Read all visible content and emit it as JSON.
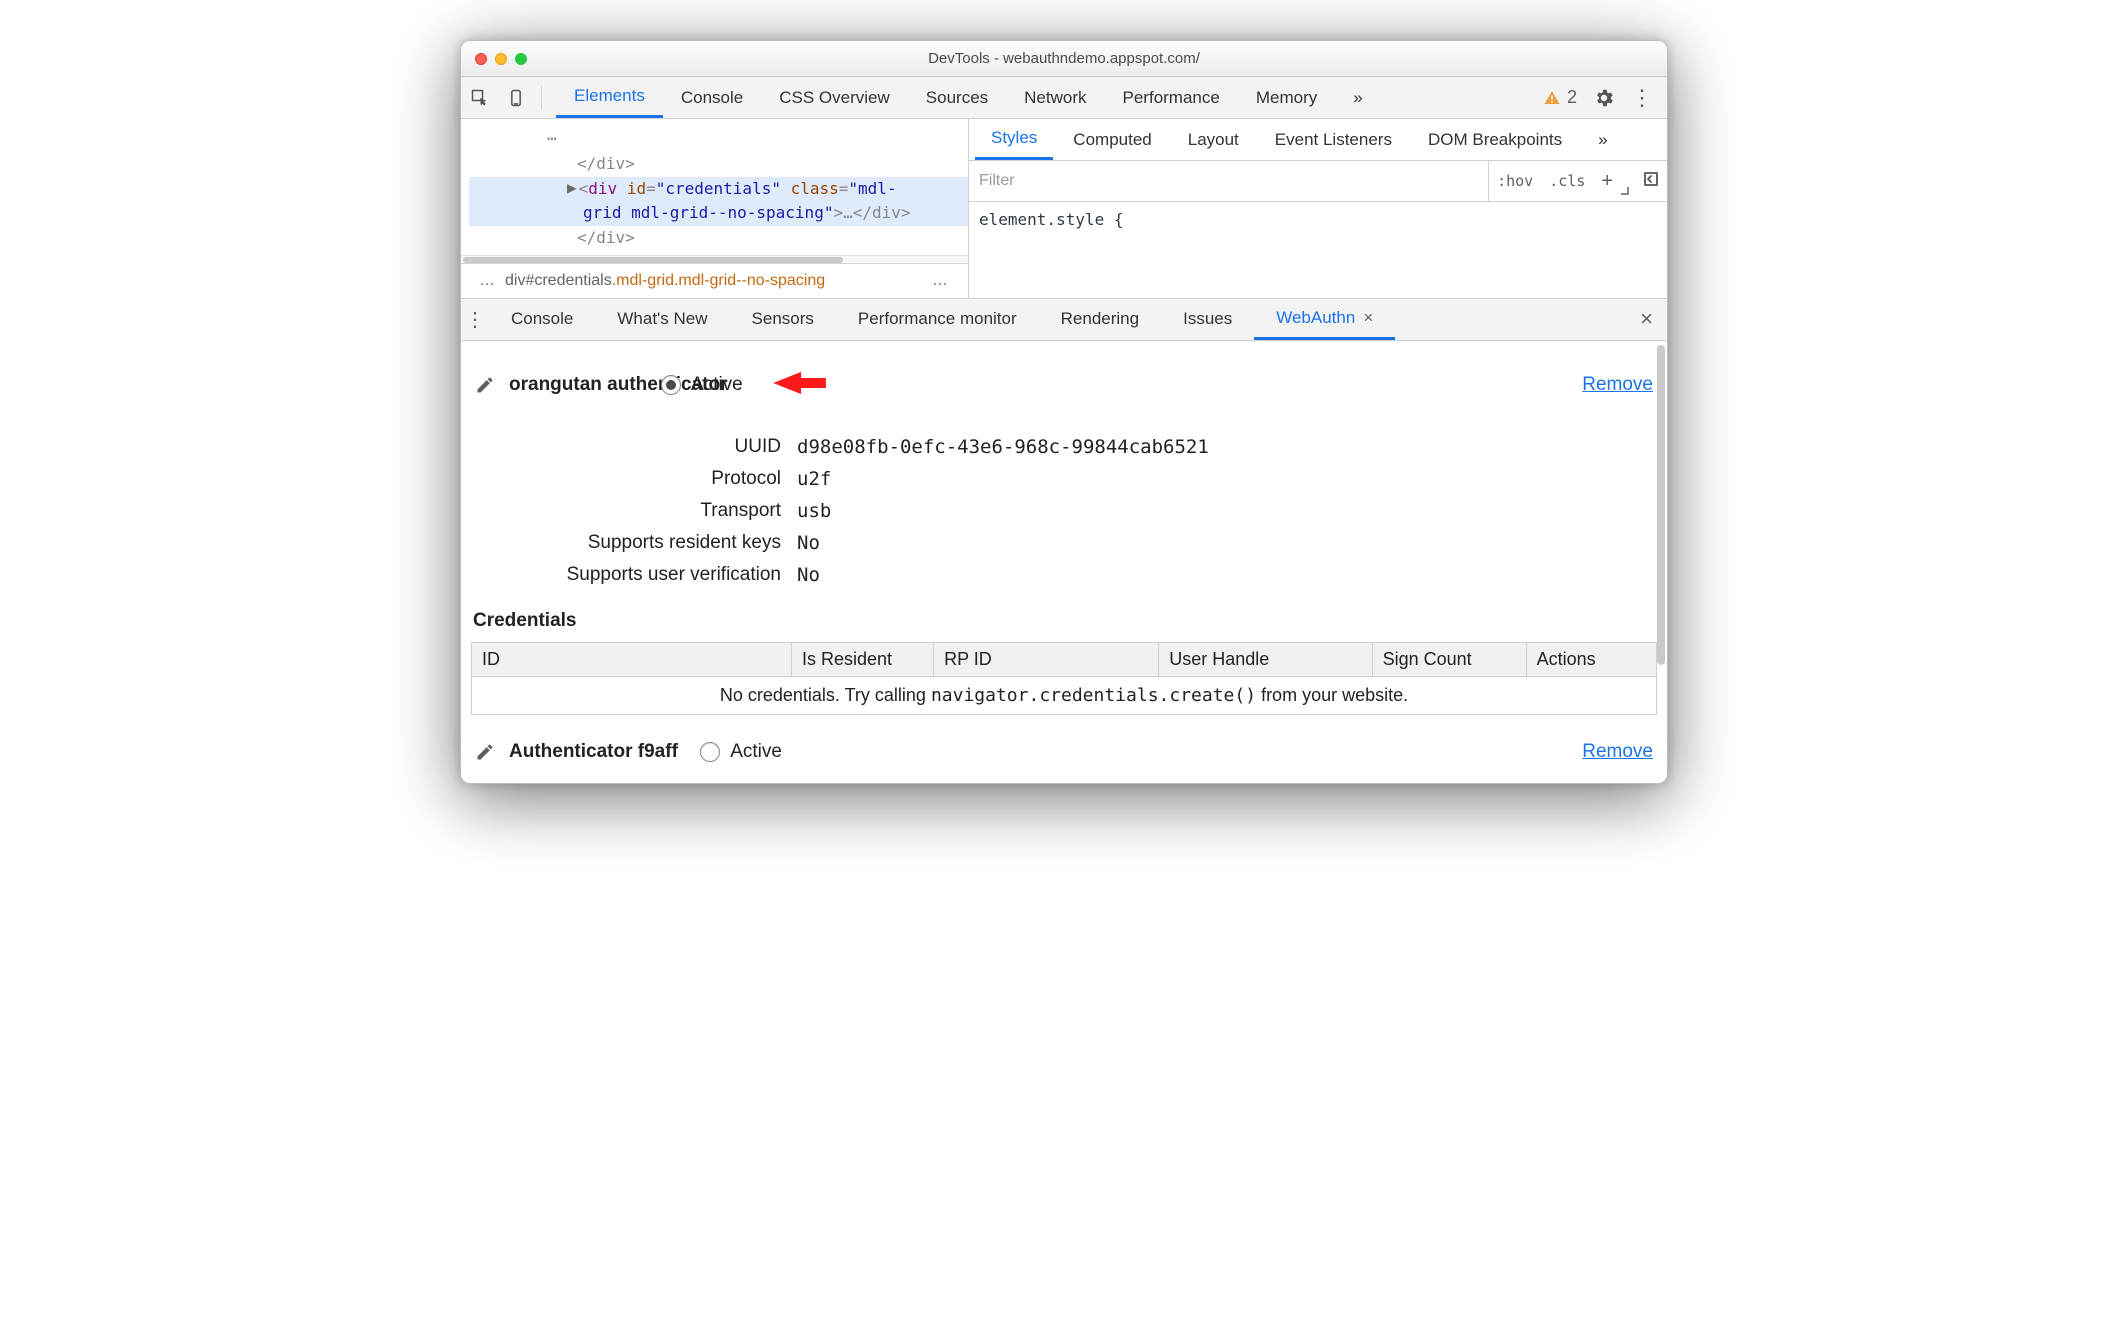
{
  "window_title": "DevTools - webauthndemo.appspot.com/",
  "main_tabs": {
    "elements": "Elements",
    "console": "Console",
    "cssoverview": "CSS Overview",
    "sources": "Sources",
    "network": "Network",
    "performance": "Performance",
    "memory": "Memory",
    "more": "»"
  },
  "warnings_count": "2",
  "elements_panel": {
    "line0": "</div>",
    "line1_a": "<",
    "line1_tag": "div",
    "line1_attr1": " id",
    "line1_eq": "=",
    "line1_val1": "\"credentials\"",
    "line1_attr2": " class",
    "line1_val2": "\"mdl-",
    "line2_val": "grid mdl-grid--no-spacing\"",
    "line2_close": ">",
    "line2_dots": "…",
    "line2_end": "</div>",
    "line3": "</div>"
  },
  "breadcrumb": {
    "dots_left": "…",
    "seg_prefix": "div#credentials",
    "seg_rest": ".mdl-grid.mdl-grid--no-spacing",
    "dots_right": "…"
  },
  "styles_tabs": {
    "styles": "Styles",
    "computed": "Computed",
    "layout": "Layout",
    "listeners": "Event Listeners",
    "dombp": "DOM Breakpoints",
    "more": "»"
  },
  "styles_panel": {
    "filter_placeholder": "Filter",
    "hov": ":hov",
    "cls": ".cls",
    "code": "element.style {"
  },
  "drawer_tabs": {
    "console": "Console",
    "whatsnew": "What's New",
    "sensors": "Sensors",
    "perfmon": "Performance monitor",
    "rendering": "Rendering",
    "issues": "Issues",
    "webauthn": "WebAuthn"
  },
  "auth1": {
    "name": "orangutan authenticator",
    "active_label": "Active",
    "remove": "Remove",
    "fields": {
      "uuid_k": "UUID",
      "uuid_v": "d98e08fb-0efc-43e6-968c-99844cab6521",
      "protocol_k": "Protocol",
      "protocol_v": "u2f",
      "transport_k": "Transport",
      "transport_v": "usb",
      "resident_k": "Supports resident keys",
      "resident_v": "No",
      "userver_k": "Supports user verification",
      "userver_v": "No"
    }
  },
  "credentials": {
    "heading": "Credentials",
    "cols": {
      "id": "ID",
      "resident": "Is Resident",
      "rp": "RP ID",
      "uh": "User Handle",
      "sc": "Sign Count",
      "actions": "Actions"
    },
    "empty_prefix": "No credentials. Try calling ",
    "empty_code": "navigator.credentials.create()",
    "empty_suffix": " from your website."
  },
  "auth2": {
    "name": "Authenticator f9aff",
    "active_label": "Active",
    "remove": "Remove"
  }
}
